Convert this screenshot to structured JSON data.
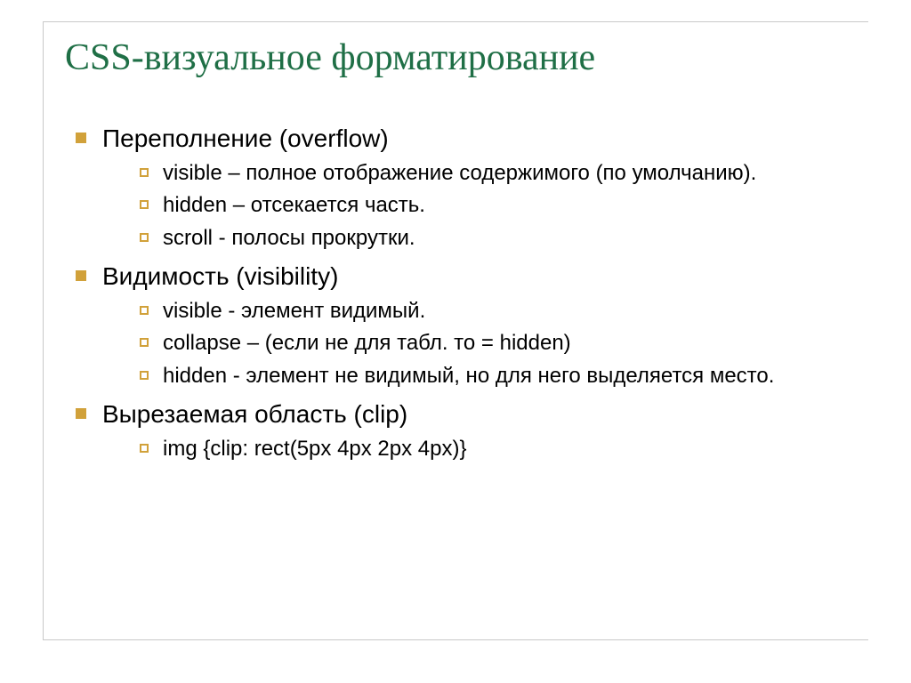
{
  "title": "CSS-визуальное форматирование",
  "sections": [
    {
      "heading": "Переполнение (overflow)",
      "items": [
        "visible – полное отображение содержимого (по умолчанию).",
        "hidden – отсекается часть.",
        "scroll - полосы прокрутки."
      ]
    },
    {
      "heading": "Видимость (visibility)",
      "items": [
        "visible - элемент видимый.",
        "collapse – (если не для табл. то = hidden)",
        "hidden - элемент не видимый, но для него выделяется место."
      ]
    },
    {
      "heading": "Вырезаемая область (clip)",
      "items": [
        "img {clip: rect(5px 4px 2px 4px)}"
      ]
    }
  ],
  "colors": {
    "title": "#1f6f46",
    "bullet": "#d1a13a",
    "frame": "#c9c9c9"
  }
}
